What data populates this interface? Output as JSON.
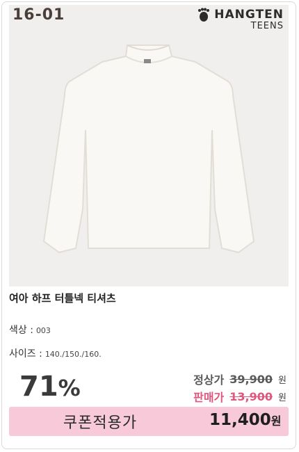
{
  "product": {
    "code": "16-01",
    "brand_name": "HANGTEN",
    "brand_sub": "TEENS",
    "title": "여아 하프 터틀넥 티셔츠",
    "color_label": "색상 :",
    "color_value": "003",
    "size_label": "사이즈 :",
    "size_value": "140./150./160."
  },
  "pricing": {
    "discount_value": "71",
    "discount_unit": "%",
    "regular_label": "정상가",
    "regular_price": "39,900",
    "regular_unit": "원",
    "sale_label": "판매가",
    "sale_price": "13,900",
    "sale_unit": "원",
    "coupon_label": "쿠폰적용가",
    "coupon_price": "11,400",
    "coupon_unit": "원"
  },
  "colors": {
    "coupon_bg": "#f7c9d9",
    "sale_text": "#e0567d"
  }
}
